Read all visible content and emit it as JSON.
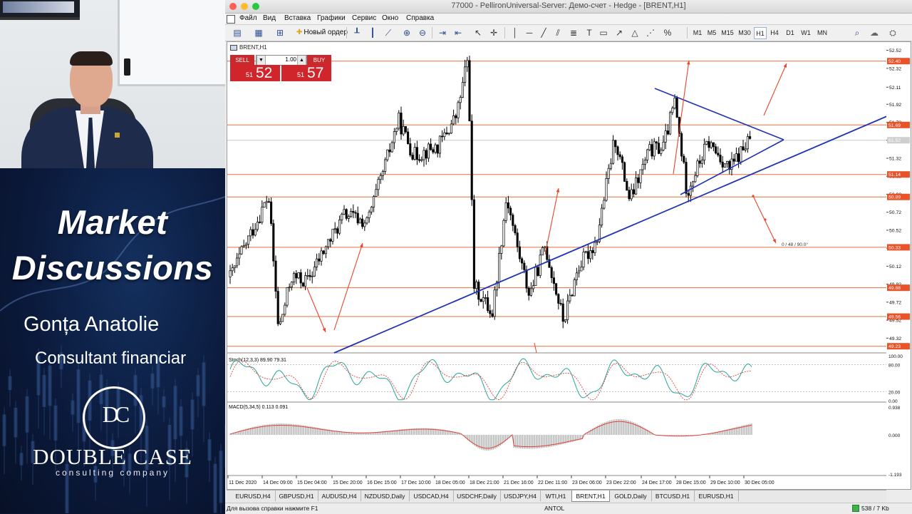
{
  "overlay": {
    "title_line1": "Market",
    "title_line2": "Discussions",
    "presenter_name": "Gonța Anatolie",
    "presenter_role": "Consultant financiar",
    "logo_monogram": "DC",
    "logo_name": "DOUBLE CASE",
    "logo_tagline": "consulting company"
  },
  "window": {
    "title": "77000 - PellironUniversal-Server: Демо-счет - Hedge - [BRENT,H1]"
  },
  "menu": [
    "Файл",
    "Вид",
    "Вставка",
    "Графики",
    "Сервис",
    "Окно",
    "Справка"
  ],
  "toolbar": {
    "new_order_label": "Новый ордер",
    "timeframes": [
      "M1",
      "M5",
      "M15",
      "M30",
      "H1",
      "H4",
      "D1",
      "W1",
      "MN"
    ],
    "active_timeframe": "H1"
  },
  "chart": {
    "symbol_label": "BRENT,H1",
    "one_click": {
      "sell_label": "SELL",
      "buy_label": "BUY",
      "lot": "1.00",
      "sell_small": "51",
      "sell_big": "52",
      "buy_small": "51",
      "buy_big": "57",
      "color_sell": "#d0262b"
    },
    "fib_label": "0 / 48 / 90.0°",
    "stoch_label": "Stoch(12,3,3) 89.90 79.31",
    "macd_label": "MACD(5,34,5) 0.113 0.091",
    "price_ticks": [
      "52.52",
      "52.32",
      "52.11",
      "51.92",
      "51.72",
      "51.52",
      "51.32",
      "51.12",
      "50.92",
      "50.72",
      "50.52",
      "50.32",
      "50.12",
      "49.92",
      "49.72",
      "49.52",
      "49.32"
    ],
    "level_labels": [
      "52.40",
      "51.69",
      "51.14",
      "50.89",
      "50.33",
      "49.88",
      "49.56",
      "49.23"
    ],
    "current_price_label": "51.52",
    "stoch_ticks": [
      "100.00",
      "80.00",
      "20.00",
      "0.00"
    ],
    "macd_ticks": [
      "0.938",
      "0.000",
      "-1.193"
    ],
    "time_labels": [
      "11 Dec 2020",
      "14 Dec 09:00",
      "15 Dec 04:00",
      "15 Dec 20:00",
      "16 Dec 15:00",
      "17 Dec 10:00",
      "18 Dec 05:00",
      "18 Dec 21:00",
      "21 Dec 16:00",
      "22 Dec 11:00",
      "23 Dec 06:00",
      "23 Dec 22:00",
      "24 Dec 17:00",
      "28 Dec 15:00",
      "29 Dec 10:00",
      "30 Dec 05:00"
    ],
    "colors": {
      "level_line": "#e0703a",
      "trend_line": "#1f33b5",
      "arrow": "#e8452a",
      "level_label_bg": "#e8532a",
      "stoch_main": "#27a59a",
      "stoch_signal": "#e0453a",
      "macd_hist": "#b0b0b0",
      "macd_signal": "#e0453a"
    }
  },
  "tabs": [
    "EURUSD,H4",
    "GBPUSD,H1",
    "AUDUSD,H4",
    "NZDUSD,Daily",
    "USDCAD,H4",
    "USDCHF,Daily",
    "USDJPY,H4",
    "WTI,H1",
    "BRENT,H1",
    "GOLD,Daily",
    "BTCUSD,H1",
    "EURUSD,H1"
  ],
  "active_tab": "BRENT,H1",
  "status": {
    "help": "Для вызова справки нажмите F1",
    "profile": "ANTOL",
    "connection": "538 / 7 Kb"
  }
}
